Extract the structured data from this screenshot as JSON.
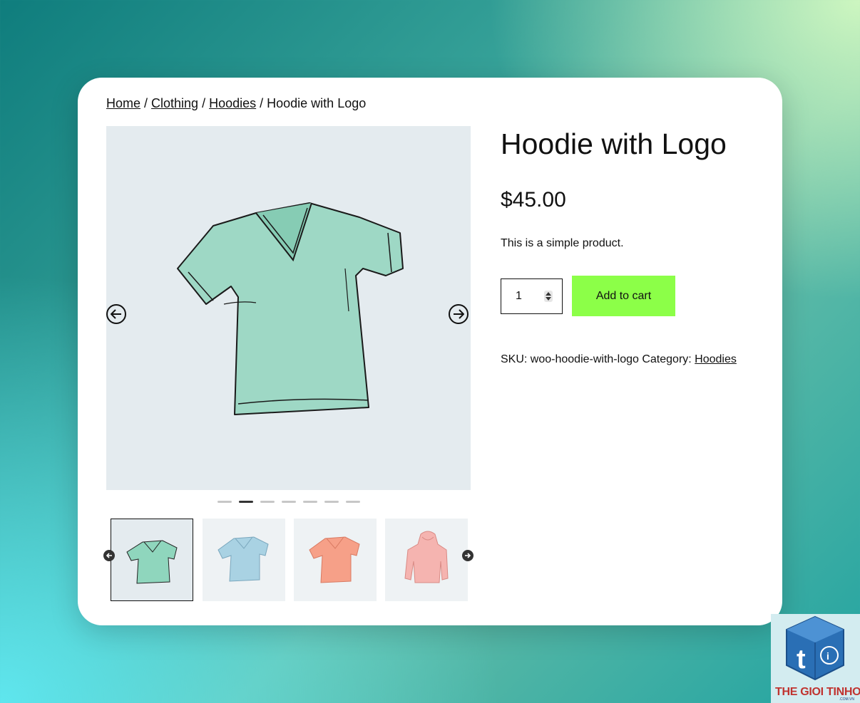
{
  "breadcrumb": {
    "home": "Home",
    "sep1": " / ",
    "clothing": "Clothing",
    "sep2": " / ",
    "hoodies": "Hoodies",
    "current": " / Hoodie with Logo"
  },
  "product": {
    "title": "Hoodie with Logo",
    "price": "$45.00",
    "description": "This is a simple product.",
    "quantity": "1",
    "add_to_cart": "Add to cart",
    "sku_label": "SKU:",
    "sku_value": "woo-hoodie-with-logo",
    "category_label": "Category:",
    "category_value": "Hoodies"
  },
  "gallery": {
    "slide_count": 7,
    "active_slide": 2,
    "thumbnails": [
      {
        "name": "green-tshirt",
        "color": "#8fd6bd"
      },
      {
        "name": "blue-tshirt",
        "color": "#a9d2e3"
      },
      {
        "name": "orange-tshirt",
        "color": "#f6a088"
      },
      {
        "name": "pink-hoodie",
        "color": "#f5b4b0"
      }
    ]
  },
  "colors": {
    "accent_button": "#8cff48",
    "main_shirt": "#9ed8c5"
  },
  "watermark": {
    "brand": "THE GIOI TINHOC",
    "domain": ".COM.VN"
  }
}
